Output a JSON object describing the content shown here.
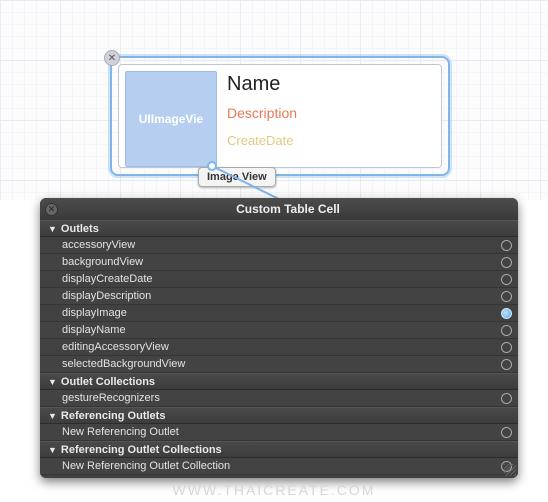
{
  "canvas": {
    "cell": {
      "imageview_label": "UIImageVie",
      "name_label": "Name",
      "description_label": "Description",
      "createdate_label": "CreateDate"
    },
    "tooltip": "Image View"
  },
  "panel": {
    "title": "Custom Table Cell",
    "sections": [
      {
        "header": "Outlets",
        "rows": [
          {
            "label": "accessoryView",
            "connected": false
          },
          {
            "label": "backgroundView",
            "connected": false
          },
          {
            "label": "displayCreateDate",
            "connected": false
          },
          {
            "label": "displayDescription",
            "connected": false
          },
          {
            "label": "displayImage",
            "connected": true
          },
          {
            "label": "displayName",
            "connected": false
          },
          {
            "label": "editingAccessoryView",
            "connected": false
          },
          {
            "label": "selectedBackgroundView",
            "connected": false
          }
        ]
      },
      {
        "header": "Outlet Collections",
        "rows": [
          {
            "label": "gestureRecognizers",
            "connected": false
          }
        ]
      },
      {
        "header": "Referencing Outlets",
        "rows": [
          {
            "label": "New Referencing Outlet",
            "connected": false
          }
        ]
      },
      {
        "header": "Referencing Outlet Collections",
        "rows": [
          {
            "label": "New Referencing Outlet Collection",
            "connected": false
          }
        ]
      }
    ]
  },
  "watermark": "WWW.THAICREATE.COM"
}
